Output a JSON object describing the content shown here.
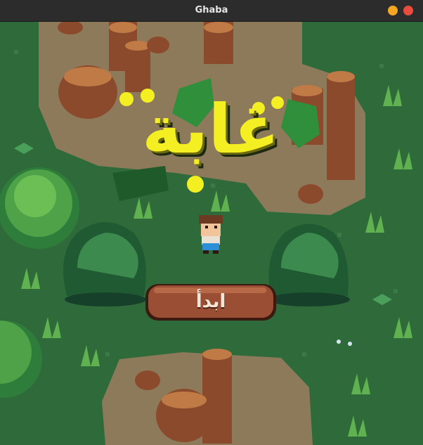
{
  "window": {
    "title": "Ghaba",
    "minimize_color": "#f4a623",
    "close_color": "#e94b3c"
  },
  "game": {
    "logo_text": "غابة",
    "logo_color": "#f4ef22",
    "start_button_label": "ابدأ",
    "button_color": "#9a4f34",
    "grass_color": "#2f6b3a",
    "path_color": "#8d7a5a"
  }
}
